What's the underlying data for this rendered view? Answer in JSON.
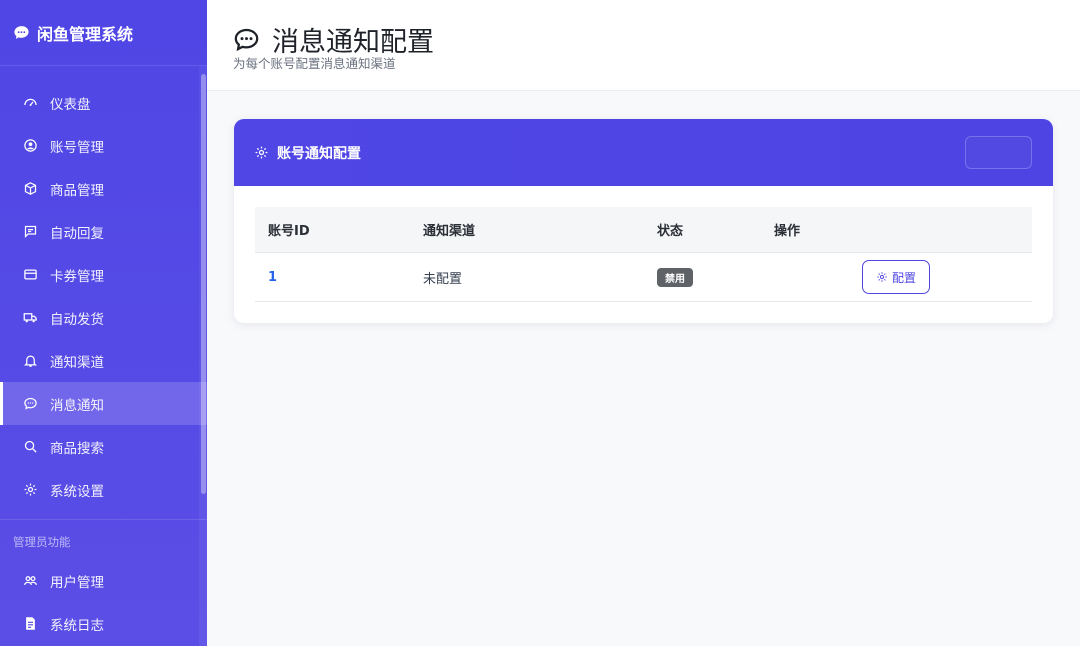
{
  "app": {
    "title": "闲鱼管理系统"
  },
  "sidebar": {
    "items": [
      {
        "label": "仪表盘",
        "icon": "dashboard-icon"
      },
      {
        "label": "账号管理",
        "icon": "user-circle-icon"
      },
      {
        "label": "商品管理",
        "icon": "box-icon"
      },
      {
        "label": "自动回复",
        "icon": "message-icon"
      },
      {
        "label": "卡券管理",
        "icon": "card-icon"
      },
      {
        "label": "自动发货",
        "icon": "truck-icon"
      },
      {
        "label": "通知渠道",
        "icon": "bell-icon"
      },
      {
        "label": "消息通知",
        "icon": "chat-icon",
        "active": true
      },
      {
        "label": "商品搜索",
        "icon": "search-icon"
      },
      {
        "label": "系统设置",
        "icon": "gear-icon"
      }
    ],
    "admin_section": {
      "title": "管理员功能",
      "items": [
        {
          "label": "用户管理",
          "icon": "users-icon"
        },
        {
          "label": "系统日志",
          "icon": "log-icon"
        }
      ]
    }
  },
  "header": {
    "title": "消息通知配置",
    "subtitle": "为每个账号配置消息通知渠道"
  },
  "card": {
    "title": "账号通知配置",
    "table": {
      "columns": [
        "账号ID",
        "通知渠道",
        "状态",
        "操作"
      ],
      "rows": [
        {
          "id": "1",
          "channel": "未配置",
          "status": "禁用",
          "action": "配置"
        }
      ]
    }
  },
  "colors": {
    "accent": "#4f46e5",
    "link": "#2563eb",
    "badge": "#5f6368"
  }
}
